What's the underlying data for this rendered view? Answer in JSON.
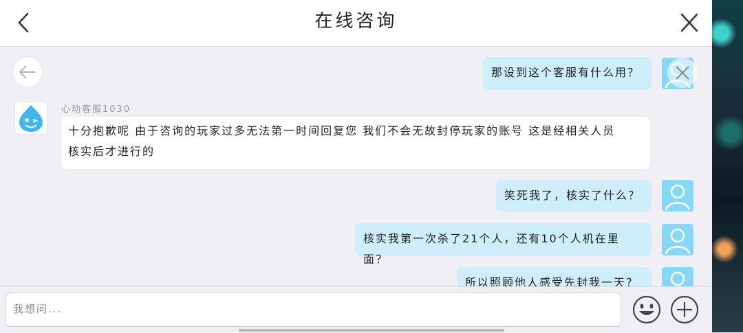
{
  "header": {
    "title": "在线咨询",
    "back_icon": "chevron-left-icon",
    "close_icon": "close-icon"
  },
  "chat": {
    "agent_name": "心动客服1030",
    "messages": [
      {
        "from": "me",
        "text": "那设到这个客服有什么用？"
      },
      {
        "from": "agent",
        "line1": "十分抱歉呢 由于咨询的玩家过多无法第一时间回复您 我们不会无故封停玩家的账号 这是经相关人员",
        "line2": "核实后才进行的"
      },
      {
        "from": "me",
        "text": "笑死我了，核实了什么？"
      },
      {
        "from": "me",
        "text": "核实我第一次杀了21个人，还有10个人机在里面？"
      },
      {
        "from": "me",
        "text": "所以照顾他人感受先封我一天？"
      }
    ]
  },
  "input": {
    "placeholder": "我想问..."
  },
  "colors": {
    "user_bubble": "#cfeefb",
    "agent_bubble": "#ffffff",
    "user_avatar": "#86d8f5"
  }
}
